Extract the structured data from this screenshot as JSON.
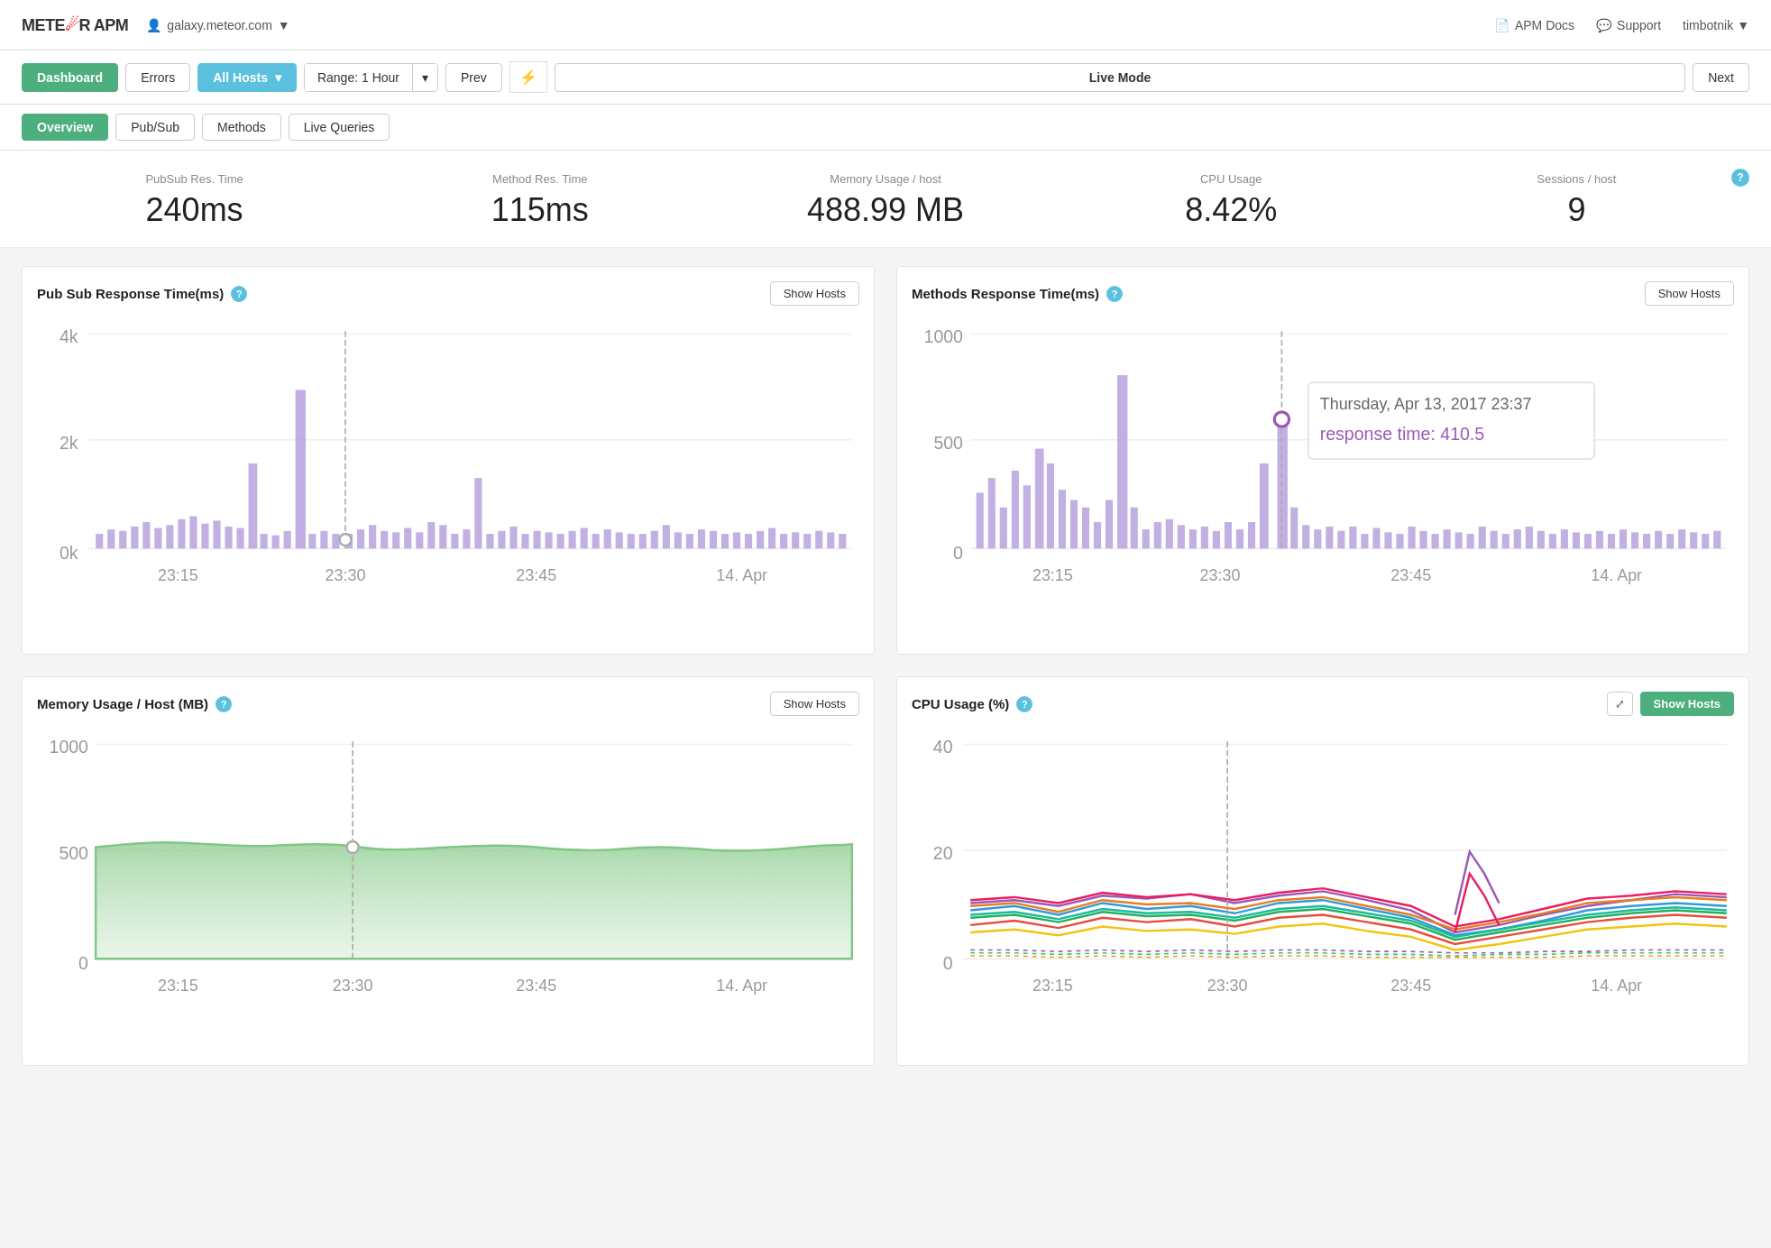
{
  "header": {
    "logo": "METE☄R APM",
    "galaxy": "galaxy.meteor.com",
    "galaxy_arrow": "▼",
    "nav": {
      "docs_icon": "📄",
      "docs_label": "APM Docs",
      "support_icon": "💬",
      "support_label": "Support",
      "user": "timbotnik",
      "user_arrow": "▼"
    }
  },
  "toolbar": {
    "dashboard_label": "Dashboard",
    "errors_label": "Errors",
    "all_hosts_label": "All Hosts",
    "all_hosts_arrow": "▾",
    "range_label": "Range: 1 Hour",
    "range_arrow": "▾",
    "prev_label": "Prev",
    "lightning": "⚡",
    "live_mode_label": "Live Mode",
    "next_label": "Next"
  },
  "subnav": {
    "overview_label": "Overview",
    "pubsub_label": "Pub/Sub",
    "methods_label": "Methods",
    "live_queries_label": "Live Queries"
  },
  "stats": {
    "pubsub_label": "PubSub Res. Time",
    "pubsub_value": "240ms",
    "method_label": "Method Res. Time",
    "method_value": "115ms",
    "memory_label": "Memory Usage / host",
    "memory_value": "488.99 MB",
    "cpu_label": "CPU Usage",
    "cpu_value": "8.42%",
    "sessions_label": "Sessions / host",
    "sessions_value": "9",
    "help": "?"
  },
  "charts": {
    "pubsub": {
      "title": "Pub Sub Response Time(ms)",
      "show_hosts": "Show Hosts",
      "y_labels": [
        "4k",
        "2k",
        "0k"
      ],
      "x_labels": [
        "23:15",
        "23:30",
        "23:45",
        "14. Apr"
      ]
    },
    "methods": {
      "title": "Methods Response Time(ms)",
      "show_hosts": "Show Hosts",
      "y_labels": [
        "1000",
        "500",
        "0"
      ],
      "x_labels": [
        "23:15",
        "23:30",
        "23:45",
        "14. Apr"
      ],
      "tooltip_date": "Thursday, Apr 13, 2017 23:37",
      "tooltip_label": "response time:",
      "tooltip_value": "410.5"
    },
    "memory": {
      "title": "Memory Usage / Host (MB)",
      "show_hosts": "Show Hosts",
      "y_labels": [
        "1000",
        "500",
        "0"
      ],
      "x_labels": [
        "23:15",
        "23:30",
        "23:45",
        "14. Apr"
      ]
    },
    "cpu": {
      "title": "CPU Usage (%)",
      "show_hosts": "Show Hosts",
      "y_labels": [
        "40",
        "20",
        "0"
      ],
      "x_labels": [
        "23:15",
        "23:30",
        "23:45",
        "14. Apr"
      ]
    }
  }
}
